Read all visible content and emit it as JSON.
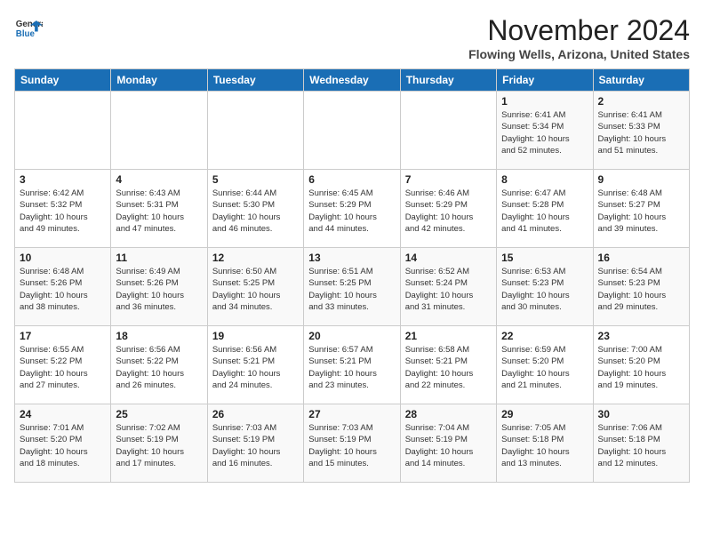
{
  "header": {
    "logo_line1": "General",
    "logo_line2": "Blue",
    "month": "November 2024",
    "location": "Flowing Wells, Arizona, United States"
  },
  "weekdays": [
    "Sunday",
    "Monday",
    "Tuesday",
    "Wednesday",
    "Thursday",
    "Friday",
    "Saturday"
  ],
  "weeks": [
    [
      {
        "day": "",
        "info": ""
      },
      {
        "day": "",
        "info": ""
      },
      {
        "day": "",
        "info": ""
      },
      {
        "day": "",
        "info": ""
      },
      {
        "day": "",
        "info": ""
      },
      {
        "day": "1",
        "info": "Sunrise: 6:41 AM\nSunset: 5:34 PM\nDaylight: 10 hours\nand 52 minutes."
      },
      {
        "day": "2",
        "info": "Sunrise: 6:41 AM\nSunset: 5:33 PM\nDaylight: 10 hours\nand 51 minutes."
      }
    ],
    [
      {
        "day": "3",
        "info": "Sunrise: 6:42 AM\nSunset: 5:32 PM\nDaylight: 10 hours\nand 49 minutes."
      },
      {
        "day": "4",
        "info": "Sunrise: 6:43 AM\nSunset: 5:31 PM\nDaylight: 10 hours\nand 47 minutes."
      },
      {
        "day": "5",
        "info": "Sunrise: 6:44 AM\nSunset: 5:30 PM\nDaylight: 10 hours\nand 46 minutes."
      },
      {
        "day": "6",
        "info": "Sunrise: 6:45 AM\nSunset: 5:29 PM\nDaylight: 10 hours\nand 44 minutes."
      },
      {
        "day": "7",
        "info": "Sunrise: 6:46 AM\nSunset: 5:29 PM\nDaylight: 10 hours\nand 42 minutes."
      },
      {
        "day": "8",
        "info": "Sunrise: 6:47 AM\nSunset: 5:28 PM\nDaylight: 10 hours\nand 41 minutes."
      },
      {
        "day": "9",
        "info": "Sunrise: 6:48 AM\nSunset: 5:27 PM\nDaylight: 10 hours\nand 39 minutes."
      }
    ],
    [
      {
        "day": "10",
        "info": "Sunrise: 6:48 AM\nSunset: 5:26 PM\nDaylight: 10 hours\nand 38 minutes."
      },
      {
        "day": "11",
        "info": "Sunrise: 6:49 AM\nSunset: 5:26 PM\nDaylight: 10 hours\nand 36 minutes."
      },
      {
        "day": "12",
        "info": "Sunrise: 6:50 AM\nSunset: 5:25 PM\nDaylight: 10 hours\nand 34 minutes."
      },
      {
        "day": "13",
        "info": "Sunrise: 6:51 AM\nSunset: 5:25 PM\nDaylight: 10 hours\nand 33 minutes."
      },
      {
        "day": "14",
        "info": "Sunrise: 6:52 AM\nSunset: 5:24 PM\nDaylight: 10 hours\nand 31 minutes."
      },
      {
        "day": "15",
        "info": "Sunrise: 6:53 AM\nSunset: 5:23 PM\nDaylight: 10 hours\nand 30 minutes."
      },
      {
        "day": "16",
        "info": "Sunrise: 6:54 AM\nSunset: 5:23 PM\nDaylight: 10 hours\nand 29 minutes."
      }
    ],
    [
      {
        "day": "17",
        "info": "Sunrise: 6:55 AM\nSunset: 5:22 PM\nDaylight: 10 hours\nand 27 minutes."
      },
      {
        "day": "18",
        "info": "Sunrise: 6:56 AM\nSunset: 5:22 PM\nDaylight: 10 hours\nand 26 minutes."
      },
      {
        "day": "19",
        "info": "Sunrise: 6:56 AM\nSunset: 5:21 PM\nDaylight: 10 hours\nand 24 minutes."
      },
      {
        "day": "20",
        "info": "Sunrise: 6:57 AM\nSunset: 5:21 PM\nDaylight: 10 hours\nand 23 minutes."
      },
      {
        "day": "21",
        "info": "Sunrise: 6:58 AM\nSunset: 5:21 PM\nDaylight: 10 hours\nand 22 minutes."
      },
      {
        "day": "22",
        "info": "Sunrise: 6:59 AM\nSunset: 5:20 PM\nDaylight: 10 hours\nand 21 minutes."
      },
      {
        "day": "23",
        "info": "Sunrise: 7:00 AM\nSunset: 5:20 PM\nDaylight: 10 hours\nand 19 minutes."
      }
    ],
    [
      {
        "day": "24",
        "info": "Sunrise: 7:01 AM\nSunset: 5:20 PM\nDaylight: 10 hours\nand 18 minutes."
      },
      {
        "day": "25",
        "info": "Sunrise: 7:02 AM\nSunset: 5:19 PM\nDaylight: 10 hours\nand 17 minutes."
      },
      {
        "day": "26",
        "info": "Sunrise: 7:03 AM\nSunset: 5:19 PM\nDaylight: 10 hours\nand 16 minutes."
      },
      {
        "day": "27",
        "info": "Sunrise: 7:03 AM\nSunset: 5:19 PM\nDaylight: 10 hours\nand 15 minutes."
      },
      {
        "day": "28",
        "info": "Sunrise: 7:04 AM\nSunset: 5:19 PM\nDaylight: 10 hours\nand 14 minutes."
      },
      {
        "day": "29",
        "info": "Sunrise: 7:05 AM\nSunset: 5:18 PM\nDaylight: 10 hours\nand 13 minutes."
      },
      {
        "day": "30",
        "info": "Sunrise: 7:06 AM\nSunset: 5:18 PM\nDaylight: 10 hours\nand 12 minutes."
      }
    ]
  ]
}
